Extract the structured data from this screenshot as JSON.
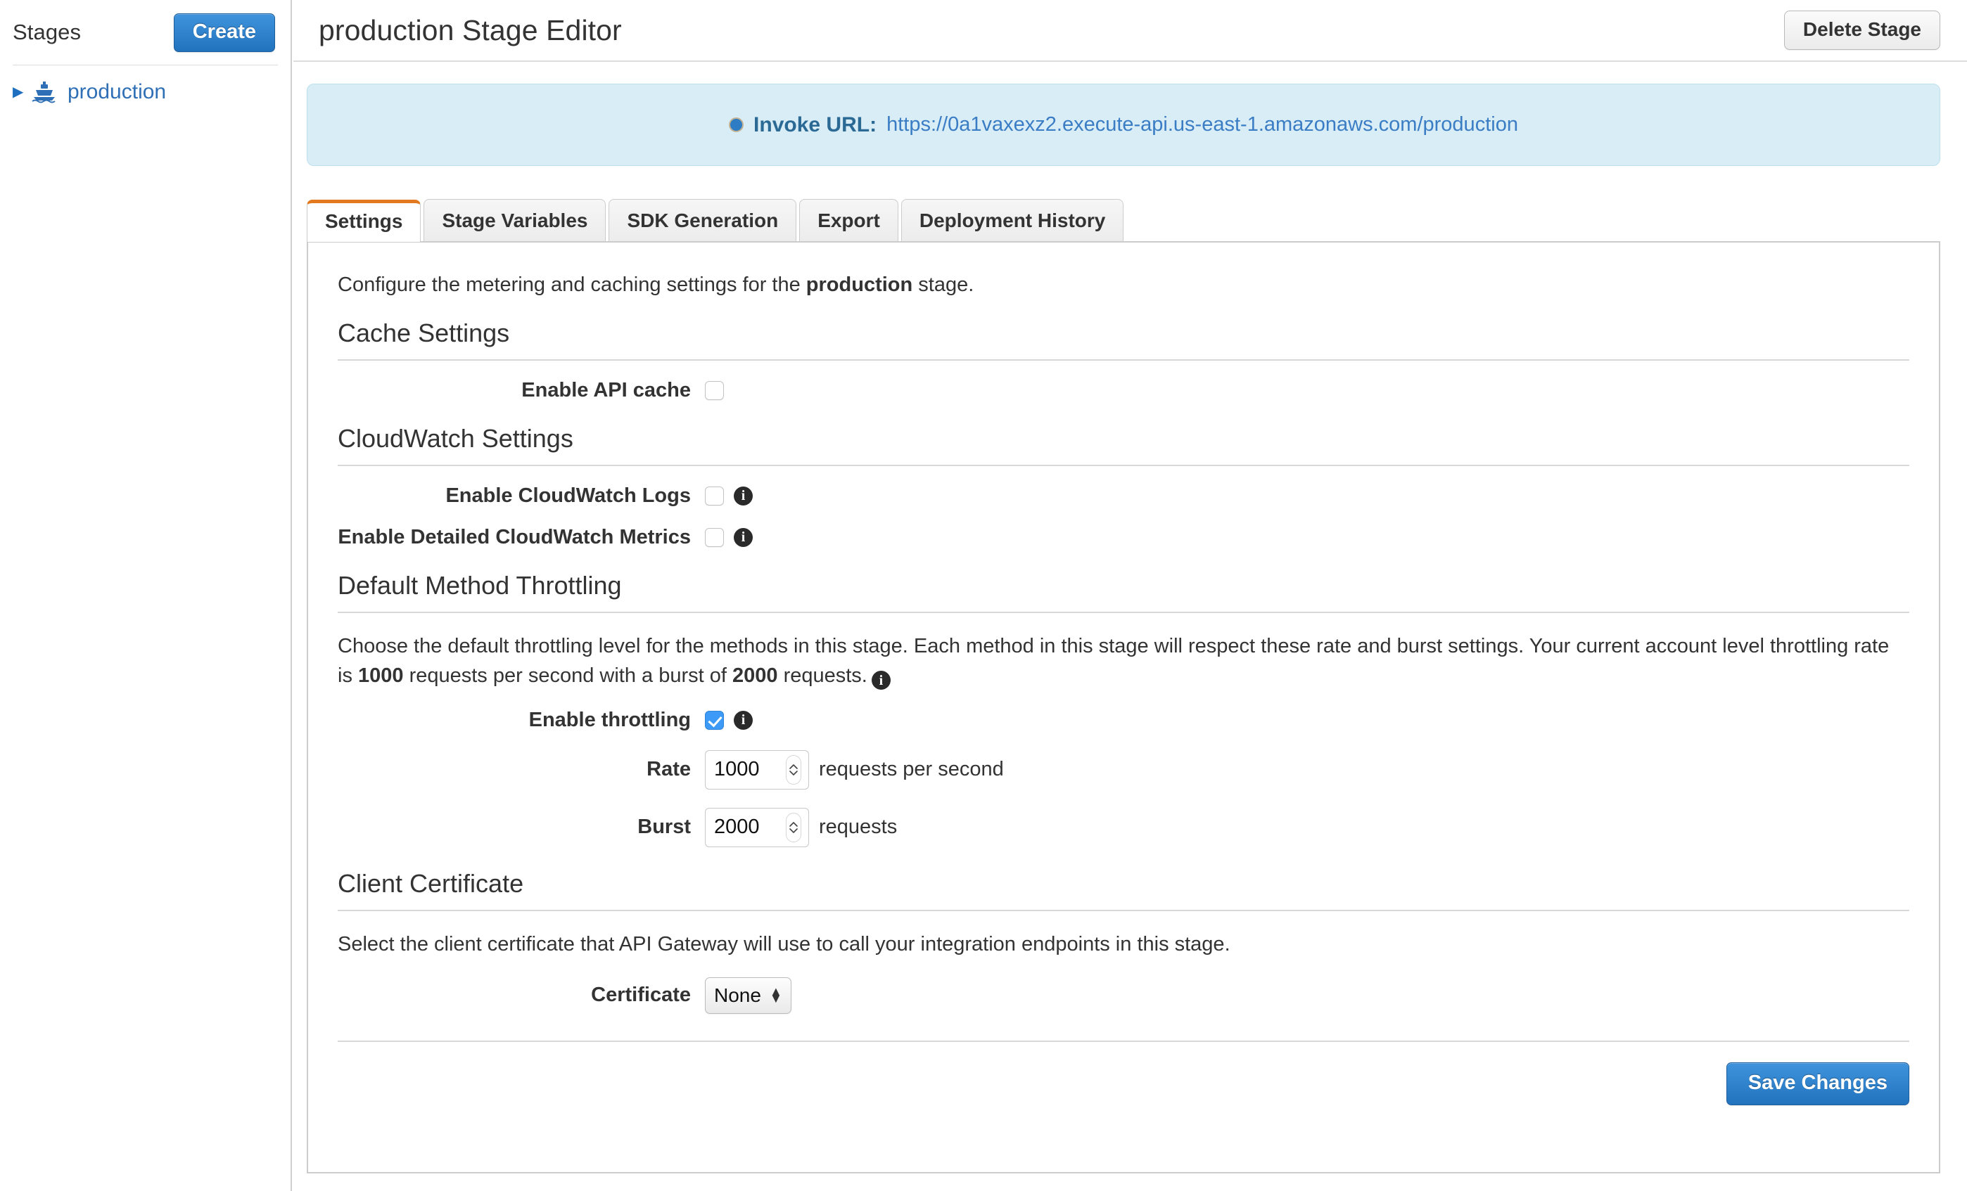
{
  "sidebar": {
    "title": "Stages",
    "create_label": "Create",
    "tree": [
      {
        "label": "production",
        "icon": "ship-icon",
        "caret": "▶"
      }
    ]
  },
  "header": {
    "title": "production Stage Editor",
    "delete_label": "Delete Stage"
  },
  "invoke_banner": {
    "label": "Invoke URL:",
    "url": "https://0a1vaxexz2.execute-api.us-east-1.amazonaws.com/production"
  },
  "tabs": [
    {
      "label": "Settings",
      "active": true
    },
    {
      "label": "Stage Variables",
      "active": false
    },
    {
      "label": "SDK Generation",
      "active": false
    },
    {
      "label": "Export",
      "active": false
    },
    {
      "label": "Deployment History",
      "active": false
    }
  ],
  "settings": {
    "intro_prefix": "Configure the metering and caching settings for the ",
    "intro_stage": "production",
    "intro_suffix": " stage.",
    "cache": {
      "heading": "Cache Settings",
      "enable_api_cache_label": "Enable API cache",
      "enable_api_cache_checked": false
    },
    "cloudwatch": {
      "heading": "CloudWatch Settings",
      "logs_label": "Enable CloudWatch Logs",
      "logs_checked": false,
      "metrics_label": "Enable Detailed CloudWatch Metrics",
      "metrics_checked": false
    },
    "throttling": {
      "heading": "Default Method Throttling",
      "description_part1": "Choose the default throttling level for the methods in this stage. Each method in this stage will respect these rate and burst settings. Your current account level throttling rate is ",
      "account_rate": "1000",
      "description_part2": " requests per second with a burst of ",
      "account_burst": "2000",
      "description_part3": " requests.",
      "enable_label": "Enable throttling",
      "enable_checked": true,
      "rate_label": "Rate",
      "rate_value": "1000",
      "rate_unit": "requests per second",
      "burst_label": "Burst",
      "burst_value": "2000",
      "burst_unit": "requests"
    },
    "certificate": {
      "heading": "Client Certificate",
      "description": "Select the client certificate that API Gateway will use to call your integration endpoints in this stage.",
      "label": "Certificate",
      "selected": "None"
    },
    "save_label": "Save Changes"
  },
  "colors": {
    "accent_blue": "#2273bd",
    "tab_active_orange": "#e3791e",
    "link_blue": "#3a7dc4",
    "banner_bg": "#d9edf7",
    "checkbox_checked": "#3d9bf7"
  }
}
